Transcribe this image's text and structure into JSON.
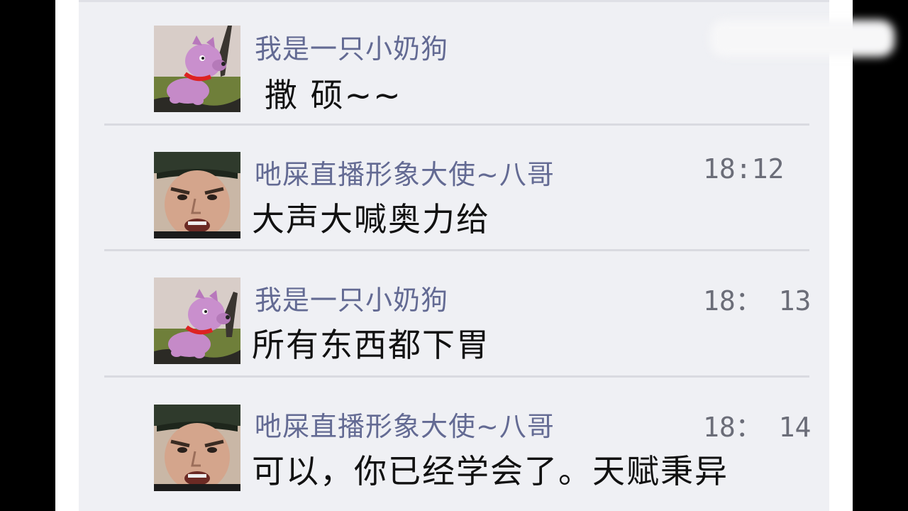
{
  "messages": [
    {
      "avatar": "pink-dog-cartoon-avatar",
      "name": "我是一只小奶狗",
      "time": "",
      "text": "撒 硕~~"
    },
    {
      "avatar": "man-green-cap-avatar",
      "name": "吔屎直播形象大使~八哥",
      "time": "18:12",
      "text": "大声大喊奥力给"
    },
    {
      "avatar": "pink-dog-cartoon-avatar",
      "name": "我是一只小奶狗",
      "time": "18： 13",
      "text": "所有东西都下胃"
    },
    {
      "avatar": "man-green-cap-avatar",
      "name": "吔屎直播形象大使~八哥",
      "time": "18： 14",
      "text": "可以，你已经学会了。天赋秉异"
    }
  ],
  "colors": {
    "list_background": "#eff0f4",
    "name_color": "#636a93",
    "divider": "#d9dae0"
  }
}
